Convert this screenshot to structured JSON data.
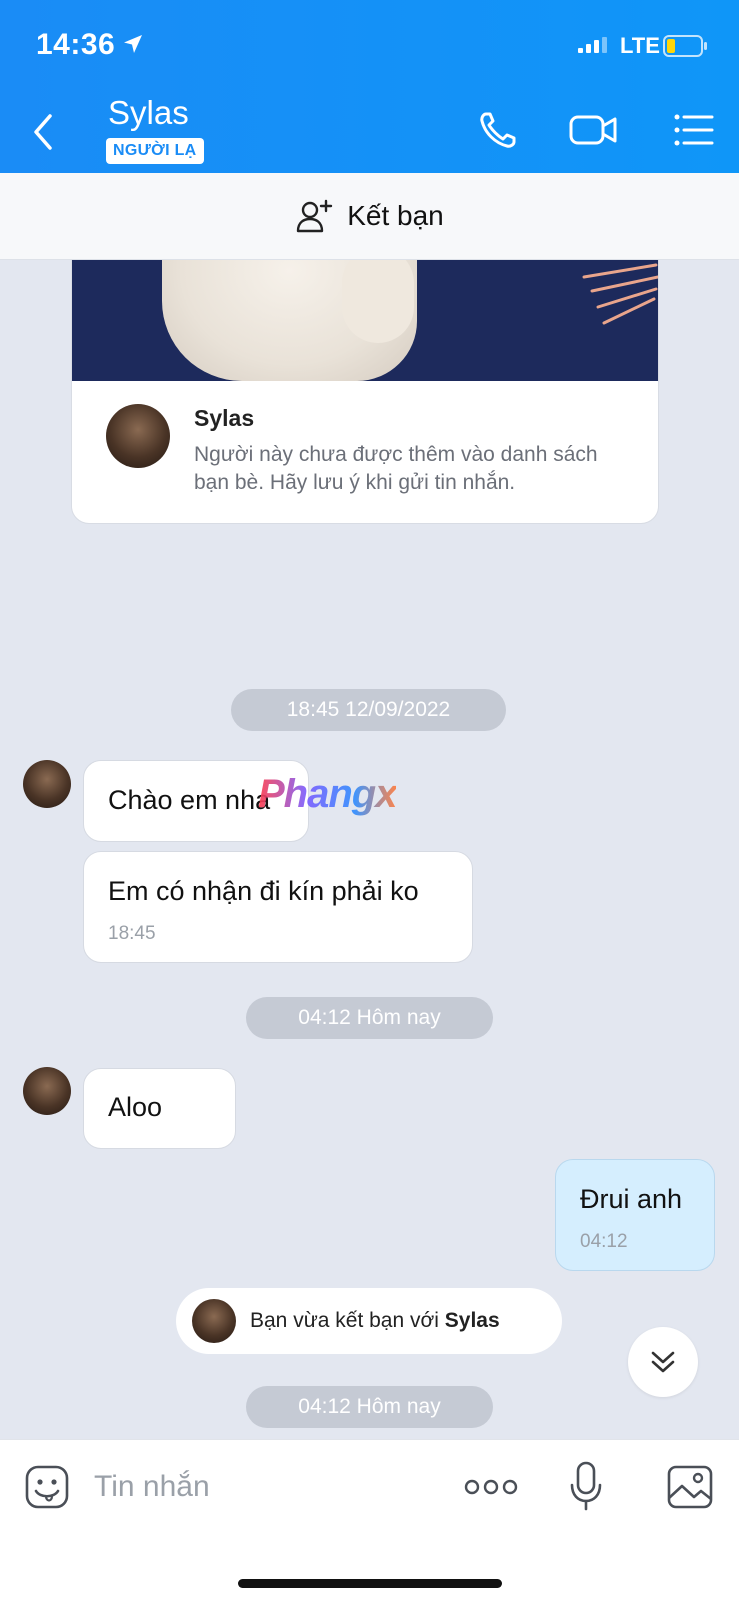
{
  "status_bar": {
    "time": "14:36",
    "network": "LTE"
  },
  "header": {
    "contact_name": "Sylas",
    "badge": "NGƯỜI LẠ"
  },
  "add_friend": {
    "label": "Kết bạn"
  },
  "profile_card": {
    "name": "Sylas",
    "description": "Người này chưa được thêm vào danh sách bạn bè. Hãy lưu ý khi gửi tin nhắn."
  },
  "chat": {
    "separators": [
      "18:45 12/09/2022",
      "04:12 Hôm nay",
      "04:12 Hôm nay"
    ],
    "messages": [
      {
        "text": "Chào em nha"
      },
      {
        "text": "Em có nhận đi kín phải ko",
        "time": "18:45"
      },
      {
        "text": "Aloo"
      },
      {
        "text": "Đrui anh",
        "time": "04:12"
      }
    ],
    "watermark": "Phangx",
    "system_notice": {
      "prefix": "Bạn vừa kết bạn với",
      "name": "Sylas"
    }
  },
  "input": {
    "placeholder": "Tin nhắn"
  },
  "colors": {
    "header": "#1a8cf6",
    "chat_bg": "#e3e7f0",
    "my_bubble": "#d5eefe",
    "time_pill": "#c5cad4"
  },
  "icons": [
    "location-arrow-icon",
    "signal-icon",
    "battery-icon",
    "back-icon",
    "phone-icon",
    "video-icon",
    "menu-list-icon",
    "add-friend-icon",
    "scroll-down-icon",
    "emoji-icon",
    "more-dots-icon",
    "microphone-icon",
    "image-icon"
  ]
}
